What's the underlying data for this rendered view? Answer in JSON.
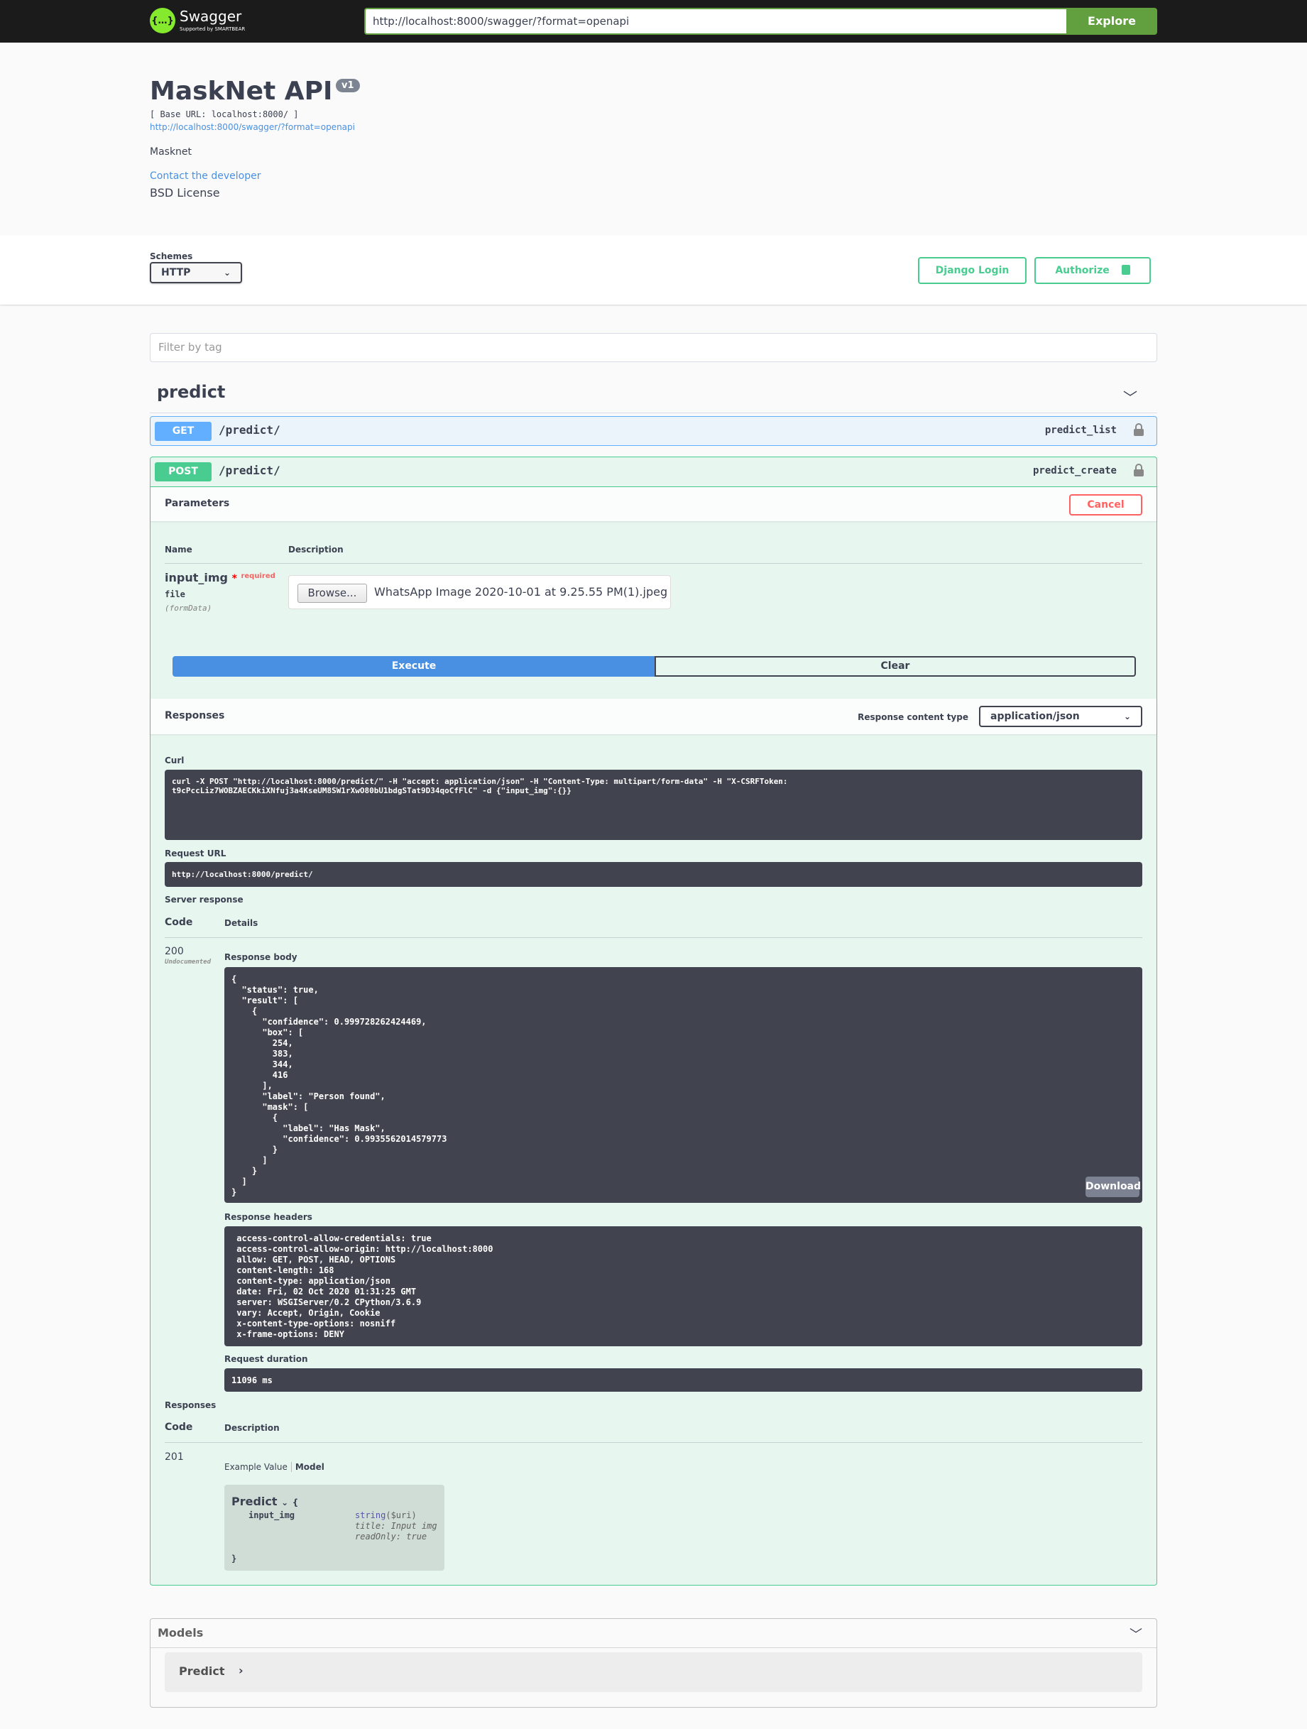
{
  "topbar": {
    "logo_text": "Swagger",
    "logo_sub": "Supported by SMARTBEAR",
    "url": "http://localhost:8000/swagger/?format=openapi",
    "explore_label": "Explore"
  },
  "info": {
    "title": "MaskNet API",
    "version": "v1",
    "base_url": "[ Base URL: localhost:8000/ ]",
    "spec_link": "http://localhost:8000/swagger/?format=openapi",
    "description": "Masknet",
    "contact": "Contact the developer",
    "license": "BSD License"
  },
  "schemes": {
    "label": "Schemes",
    "selected": "HTTP"
  },
  "auth": {
    "django_login": "Django Login",
    "authorize": "Authorize"
  },
  "filter": {
    "placeholder": "Filter by tag"
  },
  "tag": {
    "name": "predict"
  },
  "colors": {
    "get": "#61affe",
    "post": "#49cc90",
    "explore": "#62a03f",
    "cancel": "#ff6060",
    "execute": "#4990e2"
  },
  "operations": [
    {
      "method": "GET",
      "path": "/predict/",
      "operation_id": "predict_list"
    },
    {
      "method": "POST",
      "path": "/predict/",
      "operation_id": "predict_create"
    }
  ],
  "post": {
    "parameters_title": "Parameters",
    "cancel_label": "Cancel",
    "col_name": "Name",
    "col_description": "Description",
    "param": {
      "name": "input_img",
      "required_mark": "*",
      "required": "required",
      "type": "file",
      "in": "(formData)",
      "browse_label": "Browse...",
      "file_name": "WhatsApp Image 2020-10-01 at 9.25.55 PM(1).jpeg"
    },
    "execute_label": "Execute",
    "clear_label": "Clear",
    "responses_title": "Responses",
    "response_content_type_label": "Response content type",
    "response_content_type": "application/json",
    "curl_label": "Curl",
    "curl": "curl -X POST \"http://localhost:8000/predict/\" -H \"accept: application/json\" -H \"Content-Type: multipart/form-data\" -H \"X-CSRFToken: \nt9cPccLiz7WOBZAECKkiXNfuj3a4KseUM8SW1rXwO80bU1bdgSTat9D34qoCfFlC\" -d {\"input_img\":{}}",
    "request_url_label": "Request URL",
    "request_url": "http://localhost:8000/predict/",
    "server_response_label": "Server response",
    "col_code": "Code",
    "col_details": "Details",
    "response_code": "200",
    "undocumented": "Undocumented",
    "response_body_label": "Response body",
    "response_body": "{\n  \"status\": true,\n  \"result\": [\n    {\n      \"confidence\": 0.999728262424469,\n      \"box\": [\n        254,\n        383,\n        344,\n        416\n      ],\n      \"label\": \"Person found\",\n      \"mask\": [\n        {\n          \"label\": \"Has Mask\",\n          \"confidence\": 0.9935562014579773\n        }\n      ]\n    }\n  ]\n}",
    "download_label": "Download",
    "response_headers_label": "Response headers",
    "response_headers": " access-control-allow-credentials: true \n access-control-allow-origin: http://localhost:8000 \n allow: GET, POST, HEAD, OPTIONS \n content-length: 168 \n content-type: application/json \n date: Fri, 02 Oct 2020 01:31:25 GMT \n server: WSGIServer/0.2 CPython/3.6.9 \n vary: Accept, Origin, Cookie \n x-content-type-options: nosniff \n x-frame-options: DENY ",
    "request_duration_label": "Request duration",
    "request_duration": "11096 ms",
    "responses_label": "Responses",
    "col_description2": "Description",
    "doc_code": "201",
    "example_value_tab": "Example Value",
    "model_tab": "Model",
    "model": {
      "name": "Predict",
      "open_brace": "{",
      "close_brace": "}",
      "prop": "input_img",
      "type": "string",
      "format": "($uri)",
      "title": "title: Input img",
      "read_only": "readOnly: true"
    }
  },
  "models": {
    "title": "Models",
    "item": "Predict"
  }
}
